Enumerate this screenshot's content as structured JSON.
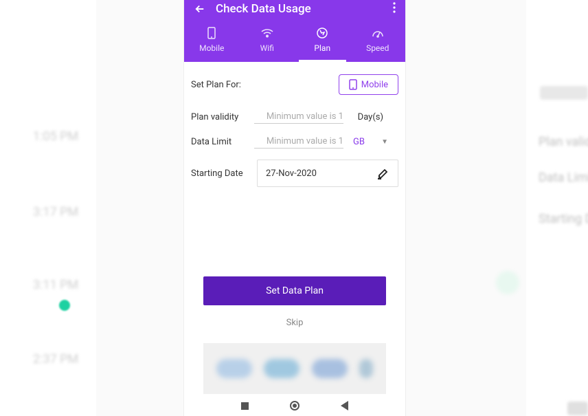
{
  "header": {
    "title": "Check Data Usage"
  },
  "tabs": [
    {
      "id": "mobile",
      "label": "Mobile"
    },
    {
      "id": "wifi",
      "label": "Wifi"
    },
    {
      "id": "plan",
      "label": "Plan"
    },
    {
      "id": "speed",
      "label": "Speed"
    }
  ],
  "form": {
    "set_plan_for_label": "Set Plan For:",
    "mobile_button": "Mobile",
    "plan_validity_label": "Plan validity",
    "plan_validity_placeholder": "Minimum value is 1",
    "plan_validity_suffix": "Day(s)",
    "data_limit_label": "Data Limit",
    "data_limit_placeholder": "Minimum value is 1",
    "data_limit_unit": "GB",
    "starting_date_label": "Starting Date",
    "starting_date_value": "27-Nov-2020"
  },
  "actions": {
    "primary": "Set Data Plan",
    "skip": "Skip"
  },
  "bg": {
    "t1": "1:05 PM",
    "t2": "3:17 PM",
    "t3": "3:11 PM",
    "t4": "2:37 PM",
    "r1": "Plan valid",
    "r2": "Data Limi",
    "r3": "Starting D"
  }
}
